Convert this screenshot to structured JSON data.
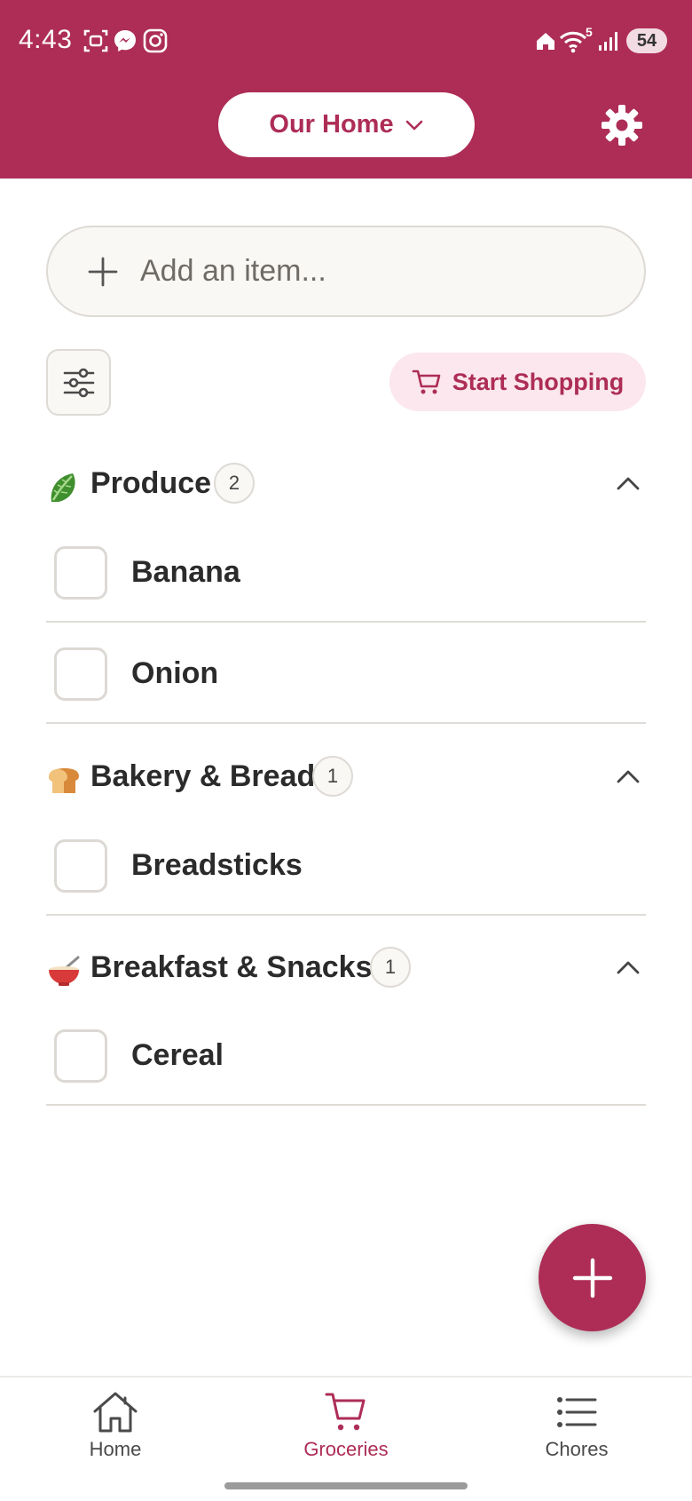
{
  "status_bar": {
    "time": "4:43",
    "battery": "54",
    "wifi_tag": "5"
  },
  "header": {
    "home_selector_label": "Our Home",
    "settings_icon": "gear-icon"
  },
  "add_item": {
    "placeholder": "Add an item..."
  },
  "toolbar": {
    "start_shopping_label": "Start Shopping"
  },
  "sections": [
    {
      "emoji": "lettuce-icon",
      "title": "Produce",
      "count": "2",
      "items": [
        "Banana",
        "Onion"
      ]
    },
    {
      "emoji": "bread-icon",
      "title": "Bakery & Bread",
      "count": "1",
      "items": [
        "Breadsticks"
      ]
    },
    {
      "emoji": "bowl-icon",
      "title": "Breakfast & Snacks",
      "count": "1",
      "items": [
        "Cereal"
      ]
    }
  ],
  "bottom_nav": [
    {
      "label": "Home",
      "icon": "house-icon",
      "active": false
    },
    {
      "label": "Groceries",
      "icon": "cart-icon",
      "active": true
    },
    {
      "label": "Chores",
      "icon": "list-icon",
      "active": false
    }
  ],
  "colors": {
    "primary": "#ad2d56",
    "primary_light": "#fbe7ed",
    "border": "#dedad5",
    "surface": "#faf8f5"
  }
}
